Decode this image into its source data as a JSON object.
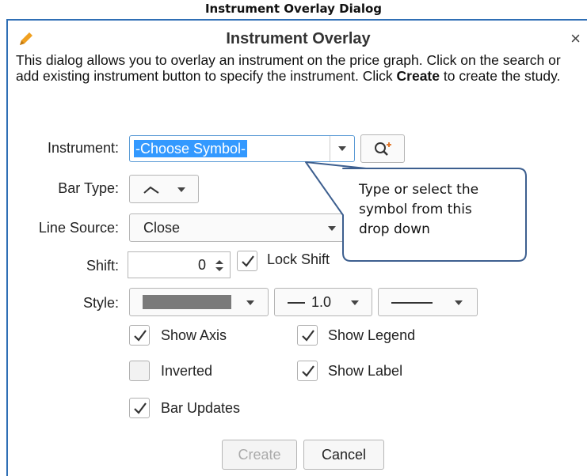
{
  "caption": "Instrument Overlay Dialog",
  "dialog": {
    "title": "Instrument Overlay",
    "close_glyph": "×",
    "description_1": "This dialog allows you to overlay an instrument on the price graph.  Click on the search or add existing instrument button to specify the instrument.  Click ",
    "description_bold": "Create",
    "description_2": " to create the study."
  },
  "form": {
    "instrument_label": "Instrument:",
    "instrument_value": "-Choose Symbol-",
    "bar_type_label": "Bar Type:",
    "line_source_label": "Line Source:",
    "line_source_value": "Close",
    "shift_label": "Shift:",
    "shift_value": "0",
    "lock_shift_label": "Lock Shift",
    "style_label": "Style:",
    "line_width_value": "1.0"
  },
  "options": {
    "show_axis": "Show Axis",
    "show_legend": "Show Legend",
    "inverted": "Inverted",
    "show_label": "Show Label",
    "bar_updates": "Bar Updates"
  },
  "buttons": {
    "create": "Create",
    "cancel": "Cancel"
  },
  "callout": {
    "line1": "Type or select the",
    "line2": "symbol from this",
    "line3": "drop down"
  },
  "colors": {
    "accent": "#2f6fb5",
    "selection": "#3399ff",
    "pencil": "#f0a020",
    "style_swatch": "#7a7a7a"
  }
}
